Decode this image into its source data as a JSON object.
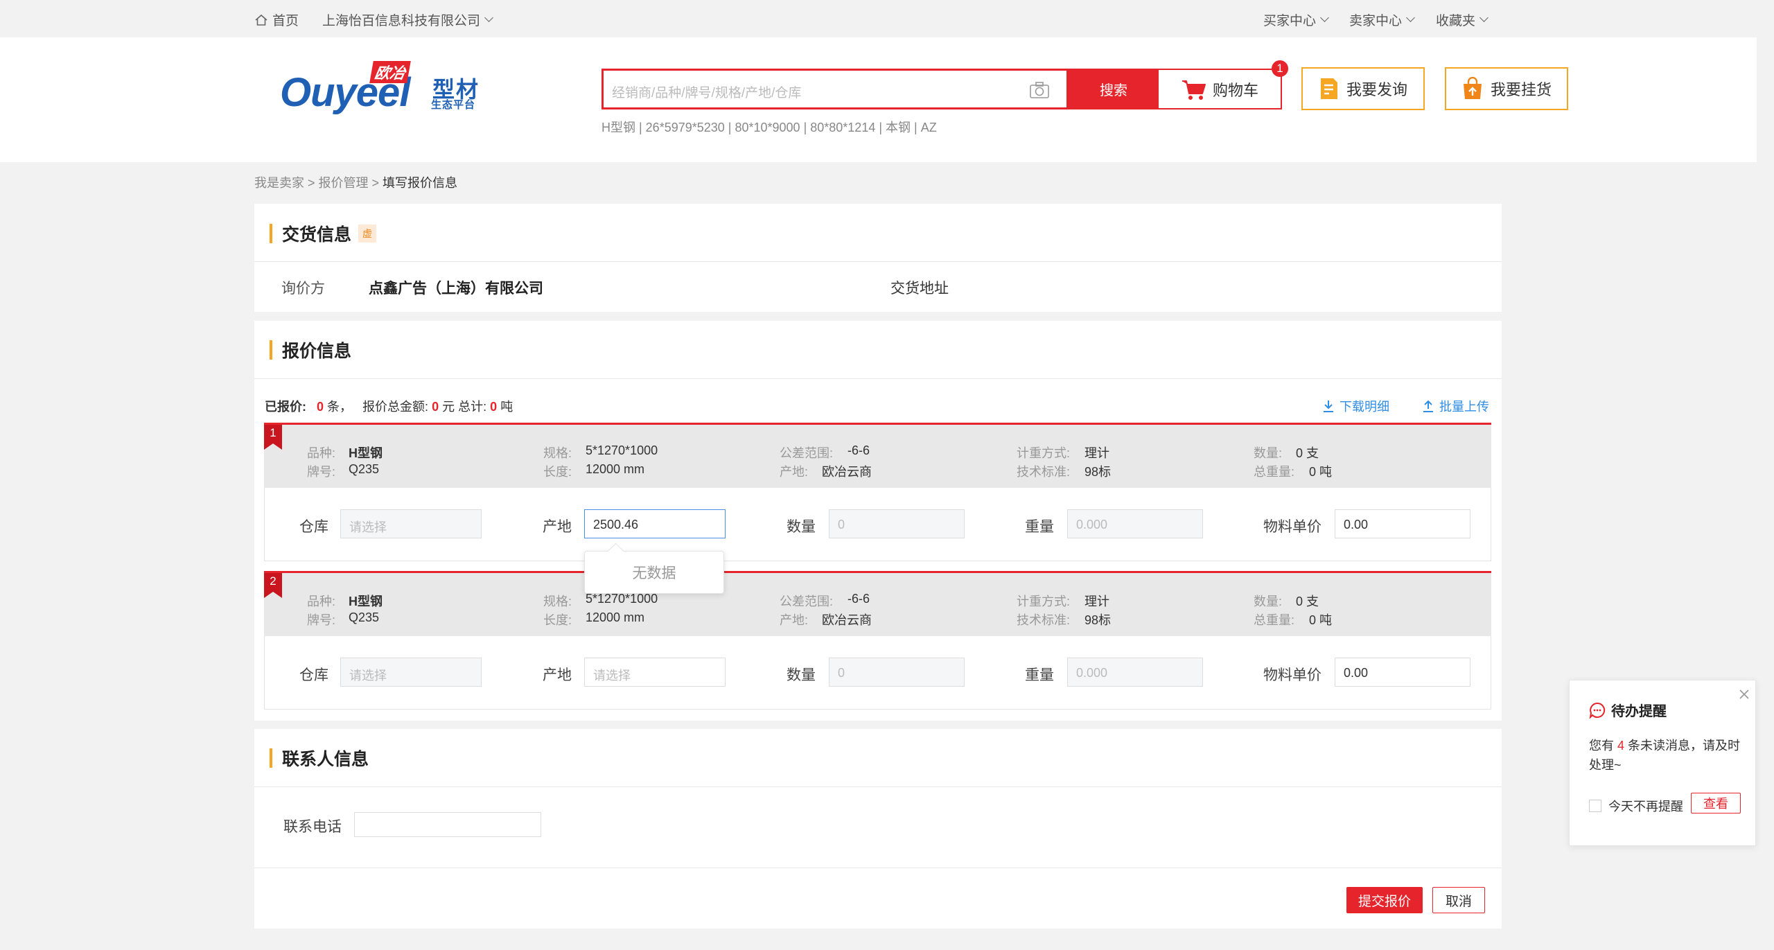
{
  "topbar": {
    "home": "首页",
    "company": "上海怡百信息科技有限公司",
    "buyer_center": "买家中心",
    "seller_center": "卖家中心",
    "favorites": "收藏夹"
  },
  "header": {
    "logo_brand": "Ouyeel",
    "logo_cn_top": "欧冶",
    "logo_cn_mid": "型材",
    "logo_cn_sub": "生态平台",
    "search_placeholder": "经销商/品种/牌号/规格/产地/仓库",
    "search_button": "搜索",
    "cart_label": "购物车",
    "cart_count": "1",
    "inquiry_button": "我要发询",
    "listing_button": "我要挂货",
    "hot_keywords": "H型钢 | 26*5979*5230 | 80*10*9000 | 80*80*1214 | 本钢 | AZ"
  },
  "breadcrumb": {
    "part1": "我是卖家",
    "sep": " > ",
    "part2": "报价管理",
    "current": "填写报价信息"
  },
  "delivery": {
    "title": "交货信息",
    "tag": "虚",
    "inquirer_label": "询价方",
    "inquirer_value": "点鑫广告（上海）有限公司",
    "address_label": "交货地址"
  },
  "quote": {
    "title": "报价信息",
    "summary_label": "已报价:",
    "count": "0",
    "count_unit": "条，",
    "amount_label": "报价总金额:",
    "amount": "0",
    "amount_unit": "元 总计:",
    "weight": "0",
    "weight_unit": "吨",
    "download": "下载明细",
    "upload": "批量上传",
    "items": [
      {
        "index": "1",
        "variety_label": "品种:",
        "variety": "H型钢",
        "grade_label": "牌号:",
        "grade": "Q235",
        "spec_label": "规格:",
        "spec": "5*1270*1000",
        "length_label": "长度:",
        "length": "12000 mm",
        "tolerance_label": "公差范围:",
        "tolerance": "-6-6",
        "origin_label": "产地:",
        "origin": "欧冶云商",
        "measure_label": "计重方式:",
        "measure": "理计",
        "standard_label": "技术标准:",
        "standard": "98标",
        "qty_label": "数量:",
        "qty": "0 支",
        "total_weight_label": "总重量:",
        "total_weight": "0 吨",
        "warehouse_label": "仓库",
        "warehouse_ph": "请选择",
        "origin_field_label": "产地",
        "origin_field_value": "2500.46",
        "quantity_label": "数量",
        "quantity_ph": "0",
        "weight_label": "重量",
        "weight_ph": "0.000",
        "price_label": "物料单价",
        "price_value": "0.00"
      },
      {
        "index": "2",
        "variety_label": "品种:",
        "variety": "H型钢",
        "grade_label": "牌号:",
        "grade": "Q235",
        "spec_label": "规格:",
        "spec": "5*1270*1000",
        "length_label": "长度:",
        "length": "12000 mm",
        "tolerance_label": "公差范围:",
        "tolerance": "-6-6",
        "origin_label": "产地:",
        "origin": "欧冶云商",
        "measure_label": "计重方式:",
        "measure": "理计",
        "standard_label": "技术标准:",
        "standard": "98标",
        "qty_label": "数量:",
        "qty": "0 支",
        "total_weight_label": "总重量:",
        "total_weight": "0 吨",
        "warehouse_label": "仓库",
        "warehouse_ph": "请选择",
        "origin_field_label": "产地",
        "origin_field_ph": "请选择",
        "quantity_label": "数量",
        "quantity_ph": "0",
        "weight_label": "重量",
        "weight_ph": "0.000",
        "price_label": "物料单价",
        "price_value": "0.00"
      }
    ],
    "dropdown_empty": "无数据"
  },
  "contact": {
    "title": "联系人信息",
    "phone_label": "联系电话",
    "phone_value": ""
  },
  "actions": {
    "submit": "提交报价",
    "cancel": "取消"
  },
  "notice": {
    "title": "待办提醒",
    "msg_prefix": "您有",
    "msg_count": "4",
    "msg_suffix": "条未读消息，请及时处理~",
    "dont_remind": "今天不再提醒",
    "view": "查看"
  },
  "colors": {
    "accent": "#e5242b",
    "orange": "#f5a623",
    "link": "#2f8de4"
  }
}
